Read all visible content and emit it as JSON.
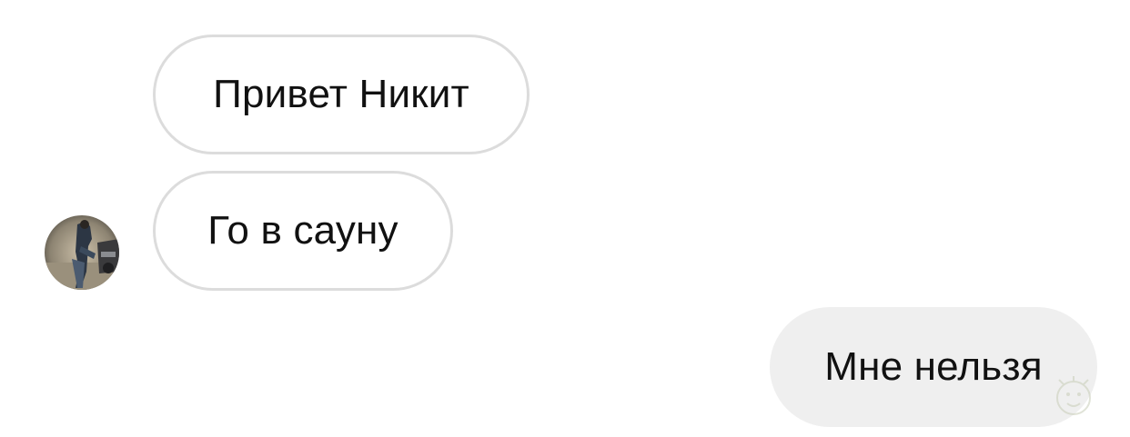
{
  "conversation": {
    "messages": [
      {
        "direction": "incoming",
        "text": "Привет Никит"
      },
      {
        "direction": "incoming",
        "text": "Го в сауну"
      },
      {
        "direction": "outgoing",
        "text": "Мне нельзя"
      }
    ],
    "sender_avatar": {
      "icon": "user-avatar-photo"
    }
  },
  "colors": {
    "background": "#ffffff",
    "incoming_bubble": "#ffffff",
    "incoming_border": "#dcdcdc",
    "outgoing_bubble": "#efefef",
    "text": "#111111"
  }
}
